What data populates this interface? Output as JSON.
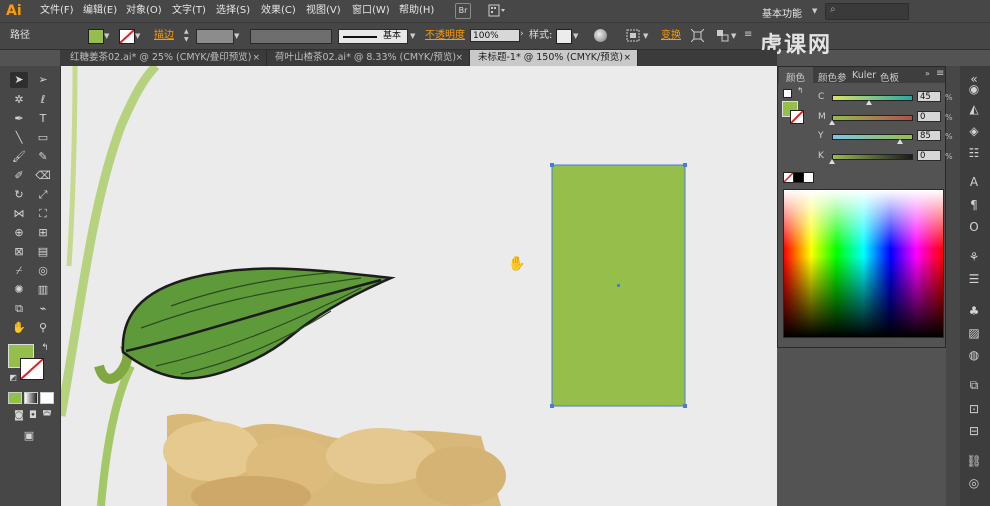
{
  "app": {
    "logo": "Ai",
    "workspace": "基本功能",
    "bridge_label": "Br"
  },
  "menu": [
    "文件(F)",
    "编辑(E)",
    "对象(O)",
    "文字(T)",
    "选择(S)",
    "效果(C)",
    "视图(V)",
    "窗口(W)",
    "帮助(H)"
  ],
  "control_bar": {
    "selection_label": "路径",
    "stroke_label": "描边",
    "stroke_style": "基本",
    "opacity_label": "不透明度",
    "opacity_value": "100%",
    "style_label": "样式:",
    "transform_label": "变换"
  },
  "tabs": [
    {
      "label": "红糖姜茶02.ai* @ 25% (CMYK/叠印预览)",
      "close": "×"
    },
    {
      "label": "荷叶山楂茶02.ai* @ 8.33% (CMYK/预览)",
      "close": "×"
    },
    {
      "label": "未标题-1* @ 150% (CMYK/预览)",
      "close": "×"
    }
  ],
  "color_panel": {
    "tabs": [
      "颜色",
      "颜色参",
      "Kuler",
      "色板"
    ],
    "sliders": [
      {
        "label": "C",
        "value": "45"
      },
      {
        "label": "M",
        "value": "0"
      },
      {
        "label": "Y",
        "value": "85"
      },
      {
        "label": "K",
        "value": "0"
      }
    ],
    "percent": "%"
  },
  "colors": {
    "fill": "#96be4a",
    "accent_orange": "#ff9a00",
    "selection_blue": "#4a7bd8",
    "canvas": "#ebebeb"
  },
  "watermark": "虎课网",
  "icons": {
    "hand_cursor": "hand-cursor-icon",
    "selection_tool": "selection-tool-icon",
    "direct_selection_tool": "direct-selection-tool-icon"
  }
}
